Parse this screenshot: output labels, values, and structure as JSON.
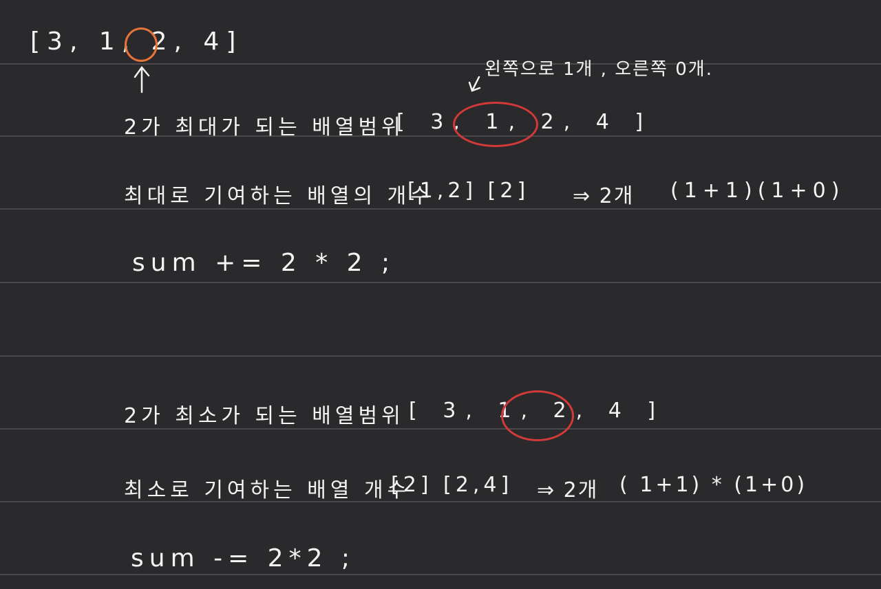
{
  "colors": {
    "background": "#2a2a2c",
    "ruled_line": "#4a4a4c",
    "ink": "#f4f4f4",
    "orange_circle": "#e8743a",
    "red_circle": "#d23a3a"
  },
  "top_array": "[3, 1, 2, 4]",
  "annotation": "왼쪽으로 1개 , 오른쪽 0개.",
  "line1": {
    "label": "2가 최대가 되는 배열범위",
    "array": "[ 3, 1, 2, 4 ]"
  },
  "line2": {
    "label": "최대로 기여하는 배열의 개수",
    "arrays": "[1,2] [2]",
    "result": "⇒ 2개",
    "formula": "(1+1)(1+0)"
  },
  "line3": {
    "code": "sum += 2 * 2 ;"
  },
  "line4": {
    "label": "2가 최소가 되는 배열범위",
    "array": "[ 3, 1, 2, 4 ]"
  },
  "line5": {
    "label": "최소로 기여하는 배열 개수",
    "arrays": "[2] [2,4]",
    "result": "⇒ 2개",
    "formula": "( 1+1) * (1+0)"
  },
  "line6": {
    "code": "sum -= 2*2 ;"
  }
}
